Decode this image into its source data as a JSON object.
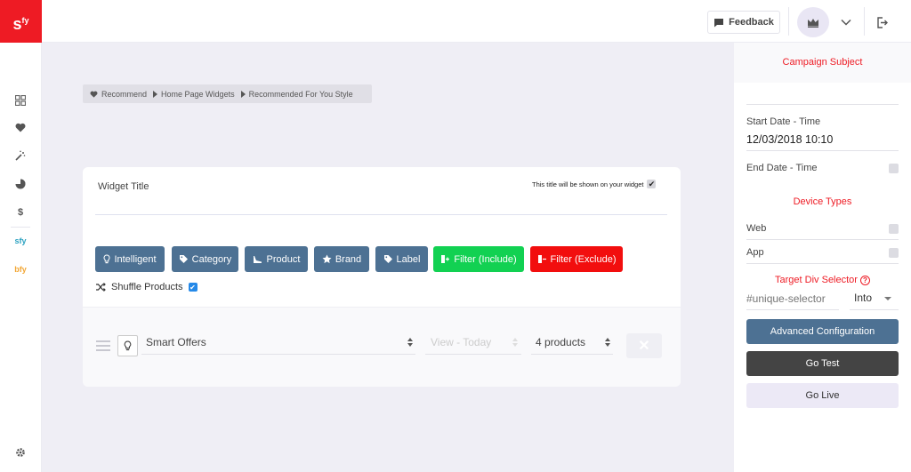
{
  "app": {
    "logo": "s",
    "logo_sup": "fy"
  },
  "topbar": {
    "feedback_label": "Feedback"
  },
  "sidebar": {
    "items": [
      {
        "name": "grid-icon"
      },
      {
        "name": "heart-icon"
      },
      {
        "name": "magic-wand-icon"
      },
      {
        "name": "pie-chart-icon"
      },
      {
        "name": "dollar-icon",
        "label": "$"
      },
      {
        "name": "sfy-brand-icon",
        "label": "sfy"
      },
      {
        "name": "bfy-brand-icon",
        "label": "bfy"
      }
    ],
    "settings": "gear-icon"
  },
  "breadcrumb": [
    "Recommend",
    "Home Page Widgets",
    "Recommended For You Style"
  ],
  "widget": {
    "title_label": "Widget Title",
    "title_hint": "This title will be shown on your widget",
    "buttons": [
      {
        "label": "Intelligent",
        "icon": "bulb-icon",
        "color": "#4d7193"
      },
      {
        "label": "Category",
        "icon": "tag-icon",
        "color": "#4d7193"
      },
      {
        "label": "Product",
        "icon": "shoe-icon",
        "color": "#4d7193"
      },
      {
        "label": "Brand",
        "icon": "star-icon",
        "color": "#4d7193"
      },
      {
        "label": "Label",
        "icon": "tag-icon",
        "color": "#4d7193"
      },
      {
        "label": "Filter (Include)",
        "icon": "filter-add-icon",
        "color": "#12d152"
      },
      {
        "label": "Filter (Exclude)",
        "icon": "filter-remove-icon",
        "color": "#f20e0e"
      }
    ],
    "shuffle_label": "Shuffle Products",
    "row": {
      "algorithm": "Smart Offers",
      "view": "View - Today",
      "count": "4 products",
      "delete": "✕"
    }
  },
  "panel": {
    "subject": "Campaign Subject",
    "start_label": "Start Date - Time",
    "start_value": "12/03/2018 10:10",
    "end_label": "End Date - Time",
    "device_types": "Device Types",
    "web": "Web",
    "app": "App",
    "target_label": "Target Div Selector",
    "help": "?",
    "selector_placeholder": "#unique-selector",
    "into": "Into",
    "advanced": "Advanced Configuration",
    "go_test": "Go Test",
    "go_live": "Go Live"
  },
  "colors": {
    "brand_red": "#ee1b24",
    "primary_blue": "#4d7193",
    "green": "#12d152",
    "dark": "#444444"
  }
}
